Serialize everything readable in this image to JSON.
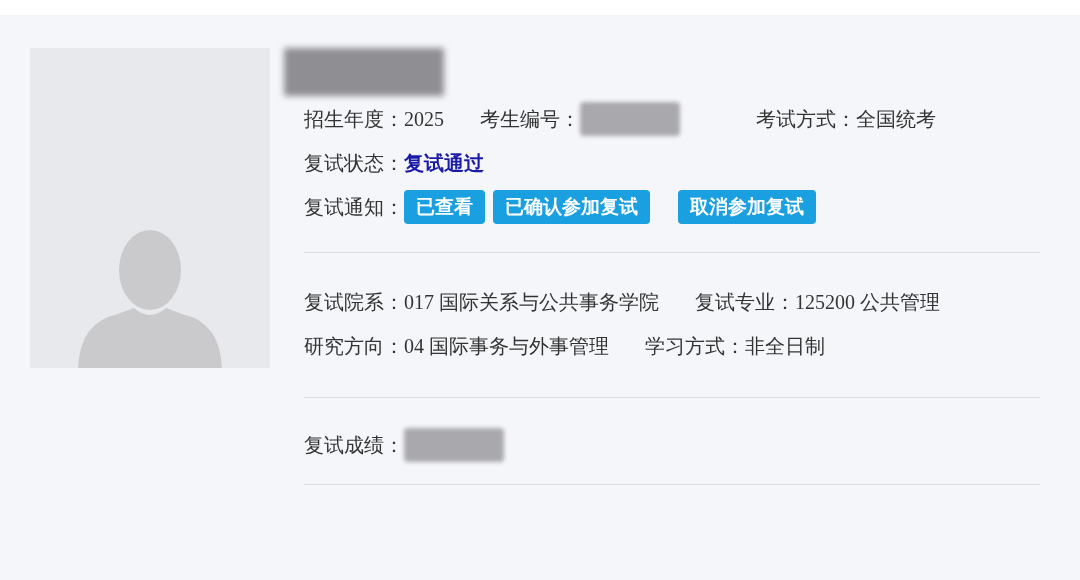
{
  "section_1": [
    [
      {
        "kind": "text",
        "label": "招生年度：",
        "value": "2025"
      },
      {
        "kind": "redacted",
        "label": "考生编号："
      },
      {
        "kind": "text",
        "label": "考试方式：",
        "value": "全国统考"
      }
    ],
    [
      {
        "kind": "status",
        "label": "复试状态：",
        "value": "复试通过"
      }
    ],
    [
      {
        "kind": "buttons",
        "label": "复试通知：",
        "buttons": [
          "已查看",
          "已确认参加复试",
          "取消参加复试"
        ]
      }
    ]
  ],
  "section_2": [
    [
      {
        "kind": "text",
        "label": "复试院系：",
        "value": "017 国际关系与公共事务学院"
      },
      {
        "kind": "text",
        "label": "复试专业：",
        "value": "125200 公共管理"
      }
    ],
    [
      {
        "kind": "text",
        "label": "研究方向：",
        "value": "04 国际事务与外事管理"
      },
      {
        "kind": "text",
        "label": "学习方式：",
        "value": "非全日制"
      }
    ]
  ],
  "section_3": [
    [
      {
        "kind": "redacted",
        "label": "复试成绩："
      }
    ]
  ]
}
